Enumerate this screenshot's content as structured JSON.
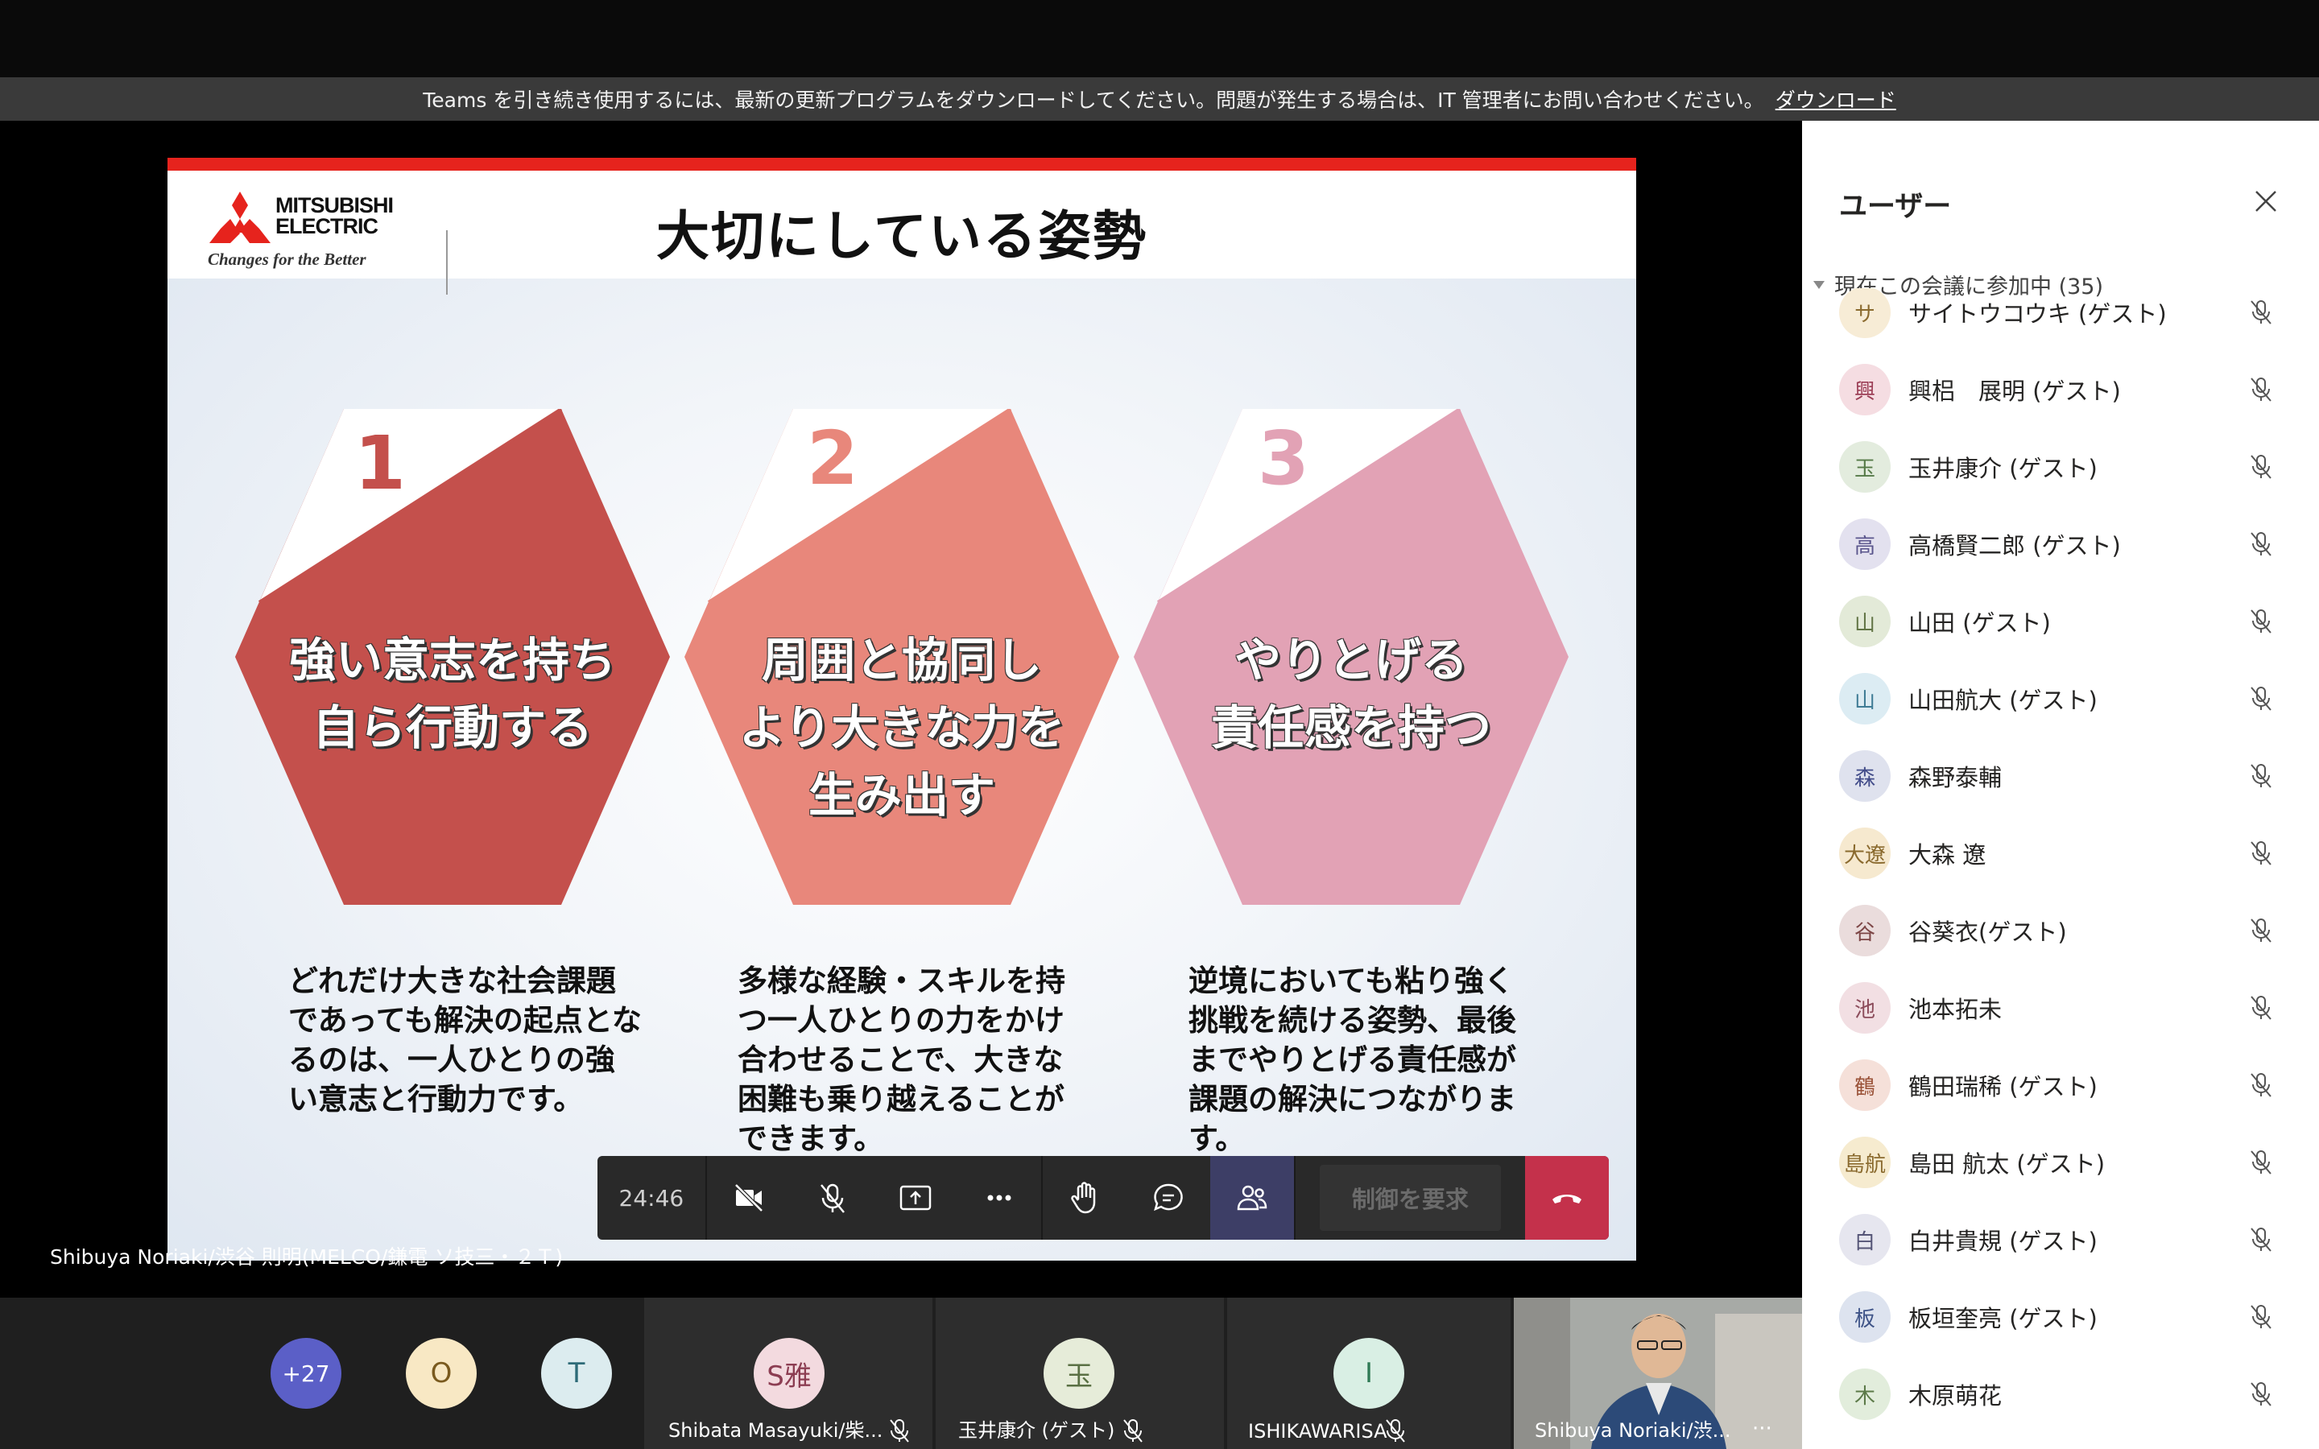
{
  "banner": {
    "message": "Teams を引き続き使用するには、最新の更新プログラムをダウンロードしてください。問題が発生する場合は、IT 管理者にお問い合わせください。",
    "link": "ダウンロード"
  },
  "slide": {
    "logo_name_line1": "MITSUBISHI",
    "logo_name_line2": "ELECTRIC",
    "logo_tagline": "Changes for the Better",
    "title": "大切にしている姿勢",
    "items": [
      {
        "num": "1",
        "line1": "強い意志を持ち",
        "line2": "自ら行動する",
        "line3": "",
        "desc": "どれだけ大きな社会課題であっても解決の起点となるのは、一人ひとりの強い意志と行動力です。",
        "color": "#c4504c"
      },
      {
        "num": "2",
        "line1": "周囲と協同し",
        "line2": "より大きな力を",
        "line3": "生み出す",
        "desc": "多様な経験・スキルを持つ一人ひとりの力をかけ合わせることで、大きな困難も乗り越えることができます。",
        "color": "#e8877b"
      },
      {
        "num": "3",
        "line1": "やりとげる",
        "line2": "責任感を持つ",
        "line3": "",
        "desc": "逆境においても粘り強く挑戦を続ける姿勢、最後までやりとげる責任感が課題の解決につながります。",
        "color": "#e2a2b5"
      }
    ]
  },
  "presenter_label": "Shibuya Noriaki/渋谷 則明(MELCO/鎌電 ソ技三・２Ｔ)",
  "controls": {
    "timer": "24:46",
    "request_control": "制御を要求"
  },
  "strip": {
    "overflow_count": "+27",
    "avatar_o": "O",
    "avatar_t": "T",
    "tiles": [
      {
        "initials": "S雅",
        "name": "Shibata Masayuki/柴..."
      },
      {
        "initials": "玉",
        "name": "玉井康介 (ゲスト)"
      },
      {
        "initials": "I",
        "name": "ISHIKAWARISA"
      }
    ],
    "camera_name": "Shibuya Noriaki/渋..."
  },
  "panel": {
    "title": "ユーザー",
    "section": "現在この会議に参加中 (35)",
    "participants": [
      {
        "initial": "サ",
        "name": "サイトウコウキ (ゲスト)",
        "bg": "#f7ecd6",
        "fg": "#8a6a2e"
      },
      {
        "initial": "興",
        "name": "興梠　展明 (ゲスト)",
        "bg": "#f5dde2",
        "fg": "#9b3d55"
      },
      {
        "initial": "玉",
        "name": "玉井康介 (ゲスト)",
        "bg": "#e3ecde",
        "fg": "#567a48"
      },
      {
        "initial": "高",
        "name": "高橋賢二郎 (ゲスト)",
        "bg": "#e3e1ef",
        "fg": "#5a558c"
      },
      {
        "initial": "山",
        "name": "山田 (ゲスト)",
        "bg": "#e3ead8",
        "fg": "#627546"
      },
      {
        "initial": "山",
        "name": "山田航大 (ゲスト)",
        "bg": "#dcecf3",
        "fg": "#3f7c95"
      },
      {
        "initial": "森",
        "name": "森野泰輔",
        "bg": "#dfe2ee",
        "fg": "#434d8a"
      },
      {
        "initial": "大遼",
        "name": "大森 遼",
        "bg": "#f6e9cf",
        "fg": "#8a6a2e"
      },
      {
        "initial": "谷",
        "name": "谷葵衣(ゲスト)",
        "bg": "#eadcdc",
        "fg": "#7d4646"
      },
      {
        "initial": "池",
        "name": "池本拓未",
        "bg": "#f2dfe3",
        "fg": "#8c4c5b"
      },
      {
        "initial": "鶴",
        "name": "鶴田瑞稀 (ゲスト)",
        "bg": "#f5e0d9",
        "fg": "#9a5238"
      },
      {
        "initial": "島航",
        "name": "島田 航太 (ゲスト)",
        "bg": "#f6ebcf",
        "fg": "#8a6a2e"
      },
      {
        "initial": "白",
        "name": "白井貴規 (ゲスト)",
        "bg": "#e6e6ef",
        "fg": "#555577"
      },
      {
        "initial": "板",
        "name": "板垣奎亮 (ゲスト)",
        "bg": "#dde3ef",
        "fg": "#3f5488"
      },
      {
        "initial": "木",
        "name": "木原萌花",
        "bg": "#e2eddc",
        "fg": "#5c7a49"
      }
    ]
  }
}
